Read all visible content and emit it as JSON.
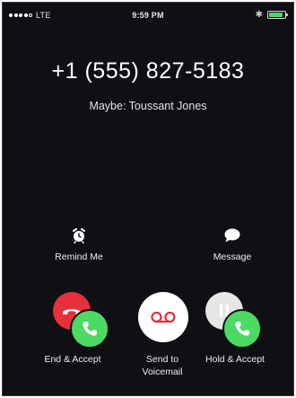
{
  "status_bar": {
    "network": "LTE",
    "time": "9:59 PM",
    "battery_level": 0.9,
    "bluetooth_icon": "bluetooth-icon"
  },
  "call": {
    "number": "+1 (555) 827-5183",
    "caller_hint": "Maybe: Toussant Jones"
  },
  "actions": {
    "remind_me": "Remind Me",
    "message": "Message",
    "end_accept": "End & Accept",
    "voicemail_line1": "Send to",
    "voicemail_line2": "Voicemail",
    "hold_accept": "Hold & Accept"
  },
  "colors": {
    "background": "#0e1014",
    "decline_red": "#e6303a",
    "accept_green": "#4cd964"
  }
}
